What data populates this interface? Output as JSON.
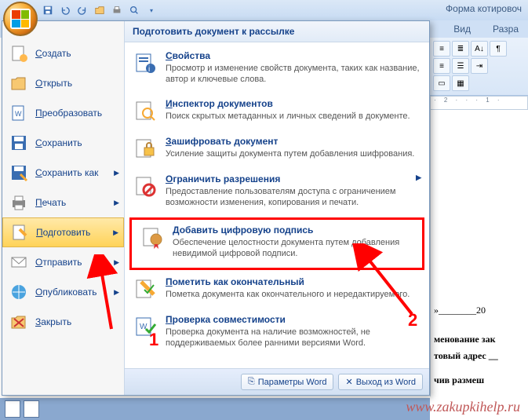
{
  "title_right": "Форма котировоч",
  "ribbon_tabs": [
    "Вид",
    "Разра"
  ],
  "ruler_text": "· 2 · · · 1 ·",
  "menu_left": [
    {
      "label": "Создать",
      "icon": "new"
    },
    {
      "label": "Открыть",
      "icon": "open"
    },
    {
      "label": "Преобразовать",
      "icon": "convert"
    },
    {
      "label": "Сохранить",
      "icon": "save"
    },
    {
      "label": "Сохранить как",
      "icon": "saveas",
      "arrow": true
    },
    {
      "label": "Печать",
      "icon": "print",
      "arrow": true
    },
    {
      "label": "Подготовить",
      "icon": "prepare",
      "arrow": true,
      "active": true
    },
    {
      "label": "Отправить",
      "icon": "send",
      "arrow": true
    },
    {
      "label": "Опубликовать",
      "icon": "publish",
      "arrow": true
    },
    {
      "label": "Закрыть",
      "icon": "close"
    }
  ],
  "menu_right_header": "Подготовить документ к рассылке",
  "submenu": [
    {
      "title": "Свойства",
      "desc": "Просмотр и изменение свойств документа, таких как название, автор и ключевые слова.",
      "icon": "props"
    },
    {
      "title": "Инспектор документов",
      "desc": "Поиск скрытых метаданных и личных сведений в документе.",
      "icon": "inspect"
    },
    {
      "title": "Зашифровать документ",
      "desc": "Усиление защиты документа путем добавления шифрования.",
      "icon": "encrypt"
    },
    {
      "title": "Ограничить разрешения",
      "desc": "Предоставление пользователям доступа с ограничением возможности изменения, копирования и печати.",
      "icon": "restrict",
      "arrow": true
    },
    {
      "title": "Добавить цифровую подпись",
      "desc": "Обеспечение целостности документа путем добавления невидимой цифровой подписи.",
      "icon": "sign",
      "highlighted": true
    },
    {
      "title": "Пометить как окончательный",
      "desc": "Пометка документа как окончательного и нередактируемого.",
      "icon": "final"
    },
    {
      "title": "Проверка совместимости",
      "desc": "Проверка документа на наличие возможностей, не поддерживаемых более ранними версиями Word.",
      "icon": "compat"
    }
  ],
  "footer": {
    "options": "Параметры Word",
    "exit": "Выход из Word"
  },
  "doc_lines": [
    "»________20",
    "менование  зак",
    "товый адрес __",
    "чив  размеш"
  ],
  "annotations": {
    "one": "1",
    "two": "2"
  },
  "watermark": "www.zakupkihelp.ru"
}
